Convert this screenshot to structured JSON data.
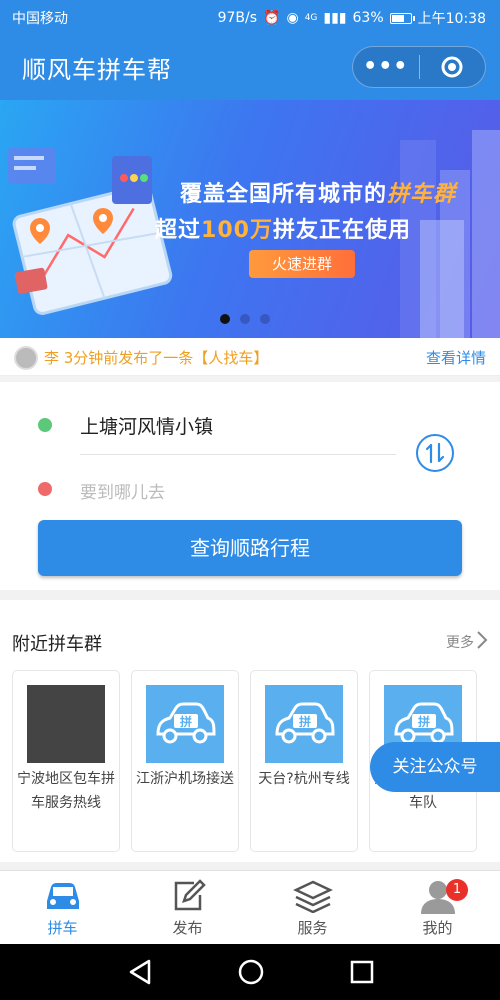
{
  "status_bar": {
    "carrier": "中国移动",
    "speed": "97B/s",
    "network": "4G",
    "battery": "63%",
    "time": "上午10:38"
  },
  "header": {
    "title": "顺风车拼车帮",
    "more_icon": "more-dots-icon",
    "close_icon": "target-icon"
  },
  "banner": {
    "line1_prefix": "覆盖全国所有城市的",
    "line1_highlight": "拼车群",
    "line2_prefix": "超过",
    "line2_highlight": "100万",
    "line2_suffix": "拼友正在使用",
    "cta": "火速进群",
    "slides": 3,
    "active_slide": 1
  },
  "notice": {
    "text": "李 3分钟前发布了一条【人找车】",
    "link": "查看详情"
  },
  "route": {
    "from": "上塘河风情小镇",
    "to_placeholder": "要到哪儿去",
    "query_button": "查询顺路行程"
  },
  "nearby": {
    "title": "附近拼车群",
    "more": "更多",
    "groups": [
      {
        "name": "宁波地区包车拼车服务热线",
        "img": "photo-collage"
      },
      {
        "name": "江浙沪机场接送",
        "img": "car-icon"
      },
      {
        "name": "天台?杭州专线",
        "img": "car-icon"
      },
      {
        "name": "萧山，舟山旅游车队",
        "img": "car-icon"
      }
    ],
    "car_badge": "拼"
  },
  "follow_button": "关注公众号",
  "tabs": [
    {
      "label": "拼车",
      "icon": "car-icon",
      "active": true
    },
    {
      "label": "发布",
      "icon": "edit-icon"
    },
    {
      "label": "服务",
      "icon": "layers-icon"
    },
    {
      "label": "我的",
      "icon": "user-icon",
      "badge": "1"
    }
  ],
  "colors": {
    "primary": "#2f8ce6",
    "orange": "#f0a020",
    "badge": "#e9312a"
  }
}
